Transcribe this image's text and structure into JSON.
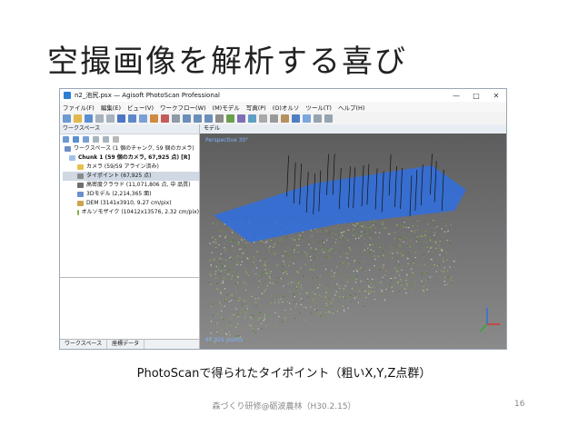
{
  "slide": {
    "title": "空撮画像を解析する喜び",
    "caption": "PhotoScanで得られたタイポイント（粗いX,Y,Z点群）",
    "footer": "森づくり研修@砺波農林（H30.2.15）",
    "page_number": "16"
  },
  "window": {
    "title": "n2_池尻.psx — Agisoft PhotoScan Professional",
    "controls": [
      "—",
      "□",
      "✕"
    ],
    "menu": [
      "ファイル(F)",
      "編集(E)",
      "ビュー(V)",
      "ワークフロー(W)",
      "(M)モデル",
      "写真(P)",
      "(O)オルソ",
      "ツール(T)",
      "ヘルプ(H)"
    ]
  },
  "workspace": {
    "header": "ワークスペース",
    "items": [
      {
        "label": "ワークスペース (1 個のチャンク, 59 個のカメラ)",
        "icon": "workspace-icon",
        "indent": 0
      },
      {
        "label": "Chunk 1 (59 個のカメラ, 67,925 点) [R]",
        "icon": "chunk-icon",
        "indent": 1,
        "bold": true
      },
      {
        "label": "カメラ (59/59 アライン済み)",
        "icon": "folder-icon",
        "indent": 2
      },
      {
        "label": "タイポイント (67,925 点)",
        "icon": "tie-points-icon",
        "indent": 2,
        "selected": true
      },
      {
        "label": "高密度クラウド (11,071,806 点, 中 品質)",
        "icon": "dense-cloud-icon",
        "indent": 2
      },
      {
        "label": "3Dモデル (2,214,365 面)",
        "icon": "mesh-icon",
        "indent": 2
      },
      {
        "label": "DEM (3141x3910, 9.27 cm/pix)",
        "icon": "dem-icon",
        "indent": 2
      },
      {
        "label": "オルソモザイク (10412x13576, 2.32 cm/pix)",
        "icon": "orthomosaic-icon",
        "indent": 2
      }
    ],
    "bottom_tabs": [
      "ワークスペース",
      "座標データ"
    ]
  },
  "model_view": {
    "tab": "モデル",
    "perspective_label": "Perspective 30°",
    "points_label": "67,925 points"
  },
  "colors": {
    "camera_plane": "#2f6fe0",
    "vegetation": "#6e9a3c",
    "viewport_bg": "#6f6f6f"
  }
}
